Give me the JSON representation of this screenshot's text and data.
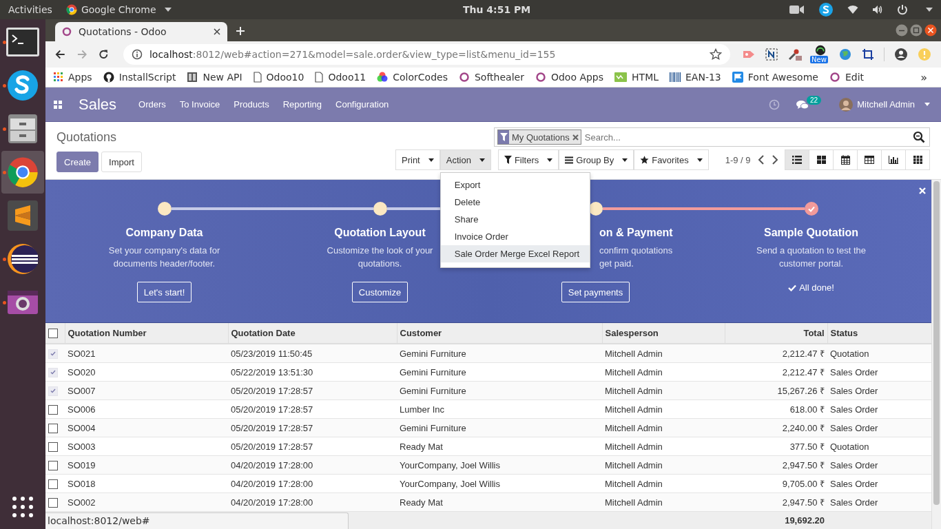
{
  "top_bar": {
    "activities": "Activities",
    "app_menu": "Google Chrome",
    "clock": "Thu  4:51 PM"
  },
  "dock": [
    {
      "kind": "terminal",
      "running": true,
      "selected": false
    },
    {
      "kind": "skype",
      "running": true,
      "selected": false
    },
    {
      "kind": "files",
      "running": true,
      "selected": false
    },
    {
      "kind": "chrome",
      "running": true,
      "selected": true
    },
    {
      "kind": "sublime",
      "running": false,
      "selected": false
    },
    {
      "kind": "eclipse",
      "running": true,
      "selected": false
    },
    {
      "kind": "camera",
      "running": true,
      "selected": false
    }
  ],
  "browser": {
    "tab_title": "Quotations - Odoo",
    "url_host": "localhost",
    "url_rest": ":8012/web#action=271&model=sale.order&view_type=list&menu_id=155",
    "extension_badge": "New",
    "bookmarks": [
      {
        "kind": "apps",
        "label": "Apps"
      },
      {
        "kind": "github",
        "label": "InstallScript"
      },
      {
        "kind": "book",
        "label": "New API"
      },
      {
        "kind": "page",
        "label": "Odoo10"
      },
      {
        "kind": "page",
        "label": "Odoo11"
      },
      {
        "kind": "colors",
        "label": "ColorCodes"
      },
      {
        "kind": "odoo",
        "label": "Softhealer"
      },
      {
        "kind": "odoo",
        "label": "Odoo Apps"
      },
      {
        "kind": "html",
        "label": "HTML"
      },
      {
        "kind": "barcode",
        "label": "EAN-13"
      },
      {
        "kind": "flag",
        "label": "Font Awesome"
      },
      {
        "kind": "odoo",
        "label": "Edit"
      }
    ],
    "more": "»"
  },
  "navbar": {
    "app": "Sales",
    "menu": [
      "Orders",
      "To Invoice",
      "Products",
      "Reporting",
      "Configuration"
    ],
    "message_count": "22",
    "user": "Mitchell Admin"
  },
  "control_panel": {
    "title": "Quotations",
    "create": "Create",
    "import": "Import",
    "print": "Print",
    "action": "Action",
    "action_open": true,
    "action_menu": [
      {
        "label": "Export",
        "selected": false
      },
      {
        "label": "Delete",
        "selected": false
      },
      {
        "label": "Share",
        "selected": false
      },
      {
        "label": "Invoice Order",
        "selected": false
      },
      {
        "label": "Sale Order Merge Excel Report",
        "selected": true
      }
    ],
    "facet": "My Quotations",
    "search_placeholder": "Search...",
    "filters": "Filters",
    "group_by": "Group By",
    "favorites": "Favorites",
    "pager": "1-9 / 9",
    "views": [
      {
        "kind": "list",
        "selected": true
      },
      {
        "kind": "kanban",
        "selected": false
      },
      {
        "kind": "calendar",
        "selected": false
      },
      {
        "kind": "pivot",
        "selected": false
      },
      {
        "kind": "graph",
        "selected": false
      },
      {
        "kind": "dashboard",
        "selected": false
      }
    ]
  },
  "onboarding": {
    "steps": [
      {
        "title": "Company Data",
        "description": [
          "Set your company's data for",
          "documents header/footer."
        ],
        "done": false,
        "partly_hidden": false,
        "button": "Let's start!"
      },
      {
        "title": "Quotation Layout",
        "description": [
          "Customize the look of your",
          "quotations."
        ],
        "done": false,
        "partly_hidden": false,
        "button": "Customize"
      },
      {
        "title": "on & Payment",
        "description": [
          "confirm quotations",
          "get paid."
        ],
        "done": false,
        "partly_hidden": true,
        "button": "Set payments"
      },
      {
        "title": "Sample Quotation",
        "description": [
          "Send a quotation to test the",
          "customer portal."
        ],
        "done": true,
        "partly_hidden": false,
        "done_label": "All done!"
      }
    ]
  },
  "table": {
    "columns": [
      "Quotation Number",
      "Quotation Date",
      "Customer",
      "Salesperson",
      "Total",
      "Status"
    ],
    "rows": [
      {
        "number": "SO021",
        "date": "05/23/2019 11:50:45",
        "customer": "Gemini Furniture",
        "salesperson": "Mitchell Admin",
        "total": "2,212.47 ₹",
        "status": "Quotation",
        "selected": true
      },
      {
        "number": "SO020",
        "date": "05/22/2019 13:51:30",
        "customer": "Gemini Furniture",
        "salesperson": "Mitchell Admin",
        "total": "2,212.47 ₹",
        "status": "Sales Order",
        "selected": true
      },
      {
        "number": "SO007",
        "date": "05/20/2019 17:28:57",
        "customer": "Gemini Furniture",
        "salesperson": "Mitchell Admin",
        "total": "15,267.26 ₹",
        "status": "Sales Order",
        "selected": true
      },
      {
        "number": "SO006",
        "date": "05/20/2019 17:28:57",
        "customer": "Lumber Inc",
        "salesperson": "Mitchell Admin",
        "total": "618.00 ₹",
        "status": "Sales Order",
        "selected": false
      },
      {
        "number": "SO004",
        "date": "05/20/2019 17:28:57",
        "customer": "Gemini Furniture",
        "salesperson": "Mitchell Admin",
        "total": "2,240.00 ₹",
        "status": "Sales Order",
        "selected": false
      },
      {
        "number": "SO003",
        "date": "05/20/2019 17:28:57",
        "customer": "Ready Mat",
        "salesperson": "Mitchell Admin",
        "total": "377.50 ₹",
        "status": "Quotation",
        "selected": false
      },
      {
        "number": "SO019",
        "date": "04/20/2019 17:28:00",
        "customer": "YourCompany, Joel Willis",
        "salesperson": "Mitchell Admin",
        "total": "2,947.50 ₹",
        "status": "Sales Order",
        "selected": false
      },
      {
        "number": "SO018",
        "date": "04/20/2019 17:28:00",
        "customer": "YourCompany, Joel Willis",
        "salesperson": "Mitchell Admin",
        "total": "9,705.00 ₹",
        "status": "Sales Order",
        "selected": false
      },
      {
        "number": "SO002",
        "date": "04/20/2019 17:28:00",
        "customer": "Ready Mat",
        "salesperson": "Mitchell Admin",
        "total": "2,947.50 ₹",
        "status": "Sales Order",
        "selected": false
      }
    ],
    "total": "19,692.20",
    "all_selected": false
  },
  "status_url": "localhost:8012/web#"
}
